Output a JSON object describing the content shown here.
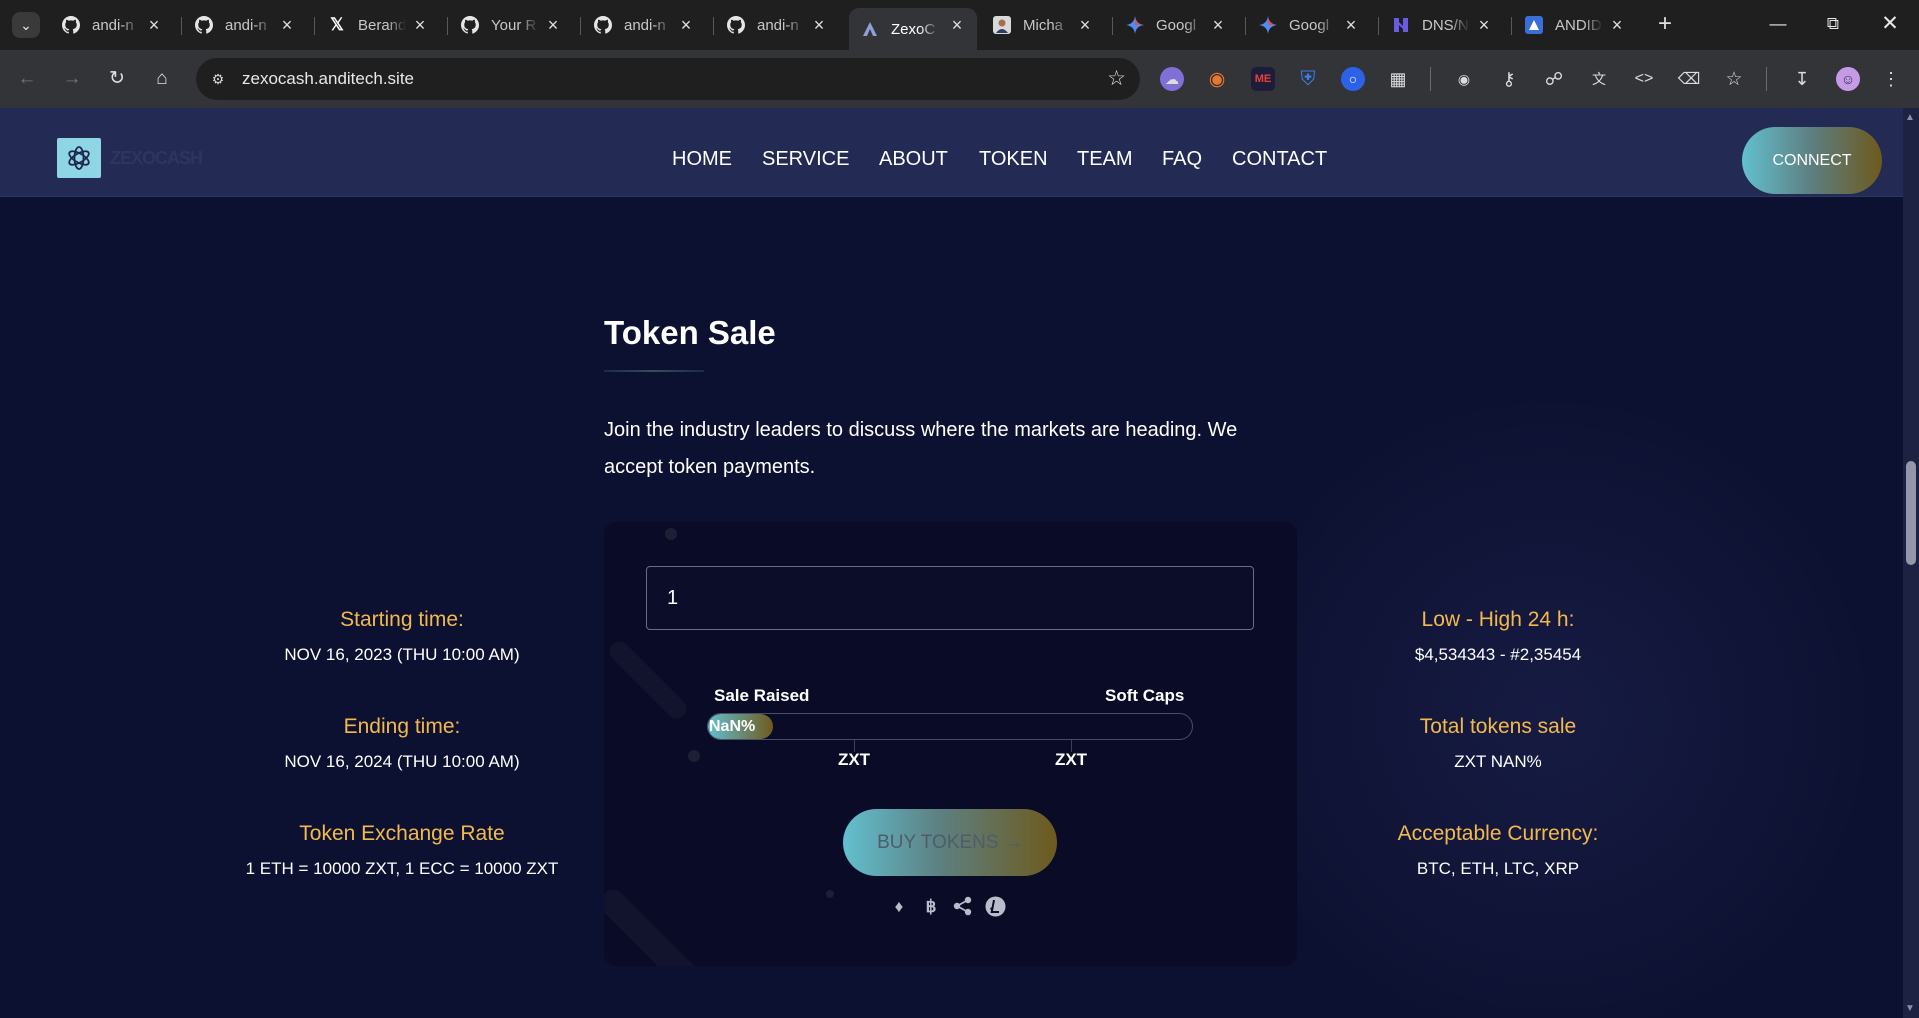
{
  "browser": {
    "tabs": [
      {
        "title": "andi-n",
        "icon": "github-icon"
      },
      {
        "title": "andi-n",
        "icon": "github-icon"
      },
      {
        "title": "Berand",
        "icon": "x-icon"
      },
      {
        "title": "Your R",
        "icon": "github-icon"
      },
      {
        "title": "andi-n",
        "icon": "github-icon"
      },
      {
        "title": "andi-n",
        "icon": "github-icon"
      },
      {
        "title": "ZexoC",
        "icon": "zexo-icon",
        "active": true
      },
      {
        "title": "Micha",
        "icon": "profile-icon"
      },
      {
        "title": "Googl",
        "icon": "gemini-icon"
      },
      {
        "title": "Googl",
        "icon": "gemini-icon"
      },
      {
        "title": "DNS/N",
        "icon": "dns-icon"
      },
      {
        "title": "ANDID",
        "icon": "andid-icon"
      }
    ],
    "url": "zexocash.anditech.site"
  },
  "site": {
    "logo_text": "ZEXOCASH",
    "nav": [
      "HOME",
      "SERVICE",
      "ABOUT",
      "TOKEN",
      "TEAM",
      "FAQ",
      "CONTACT"
    ],
    "connect_label": "CONNECT"
  },
  "token_sale": {
    "title": "Token Sale",
    "description": "Join the industry leaders to discuss where the markets are heading. We accept token payments.",
    "left_info": [
      {
        "label": "Starting time:",
        "value": "NOV 16, 2023 (THU 10:00 AM)"
      },
      {
        "label": "Ending time:",
        "value": "NOV 16, 2024 (THU 10:00 AM)"
      },
      {
        "label": "Token Exchange Rate",
        "value": "1 ETH = 10000 ZXT, 1 ECC = 10000 ZXT"
      }
    ],
    "right_info": [
      {
        "label": "Low - High 24 h:",
        "value": "$4,534343 - #2,35454"
      },
      {
        "label": "Total tokens sale",
        "value": "ZXT NAN%"
      },
      {
        "label": "Acceptable Currency:",
        "value": "BTC, ETH, LTC, XRP"
      }
    ],
    "amount_value": "1",
    "sale_raised_label": "Sale Raised",
    "soft_caps_label": "Soft Caps",
    "progress_text": "NaN%",
    "tick_labels": [
      "ZXT",
      "ZXT"
    ],
    "buy_label": "BUY TOKENS →",
    "currency_icons": [
      "ethereum-icon",
      "bitcoin-icon",
      "ripple-icon",
      "litecoin-icon"
    ]
  },
  "colors": {
    "page_bg": "#0d1131",
    "header_bg": "#232a54",
    "accent_gold": "#f3b94d",
    "gradient_start": "#62c0cf",
    "gradient_end": "#6e5a1c"
  }
}
